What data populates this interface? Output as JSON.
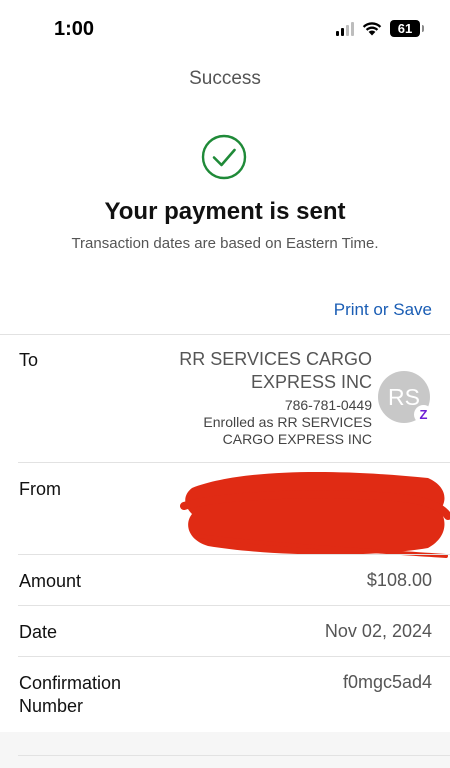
{
  "status_bar": {
    "time": "1:00",
    "battery": "61",
    "icons": [
      "signal-icon",
      "wifi-icon",
      "battery-icon"
    ]
  },
  "nav": {
    "title": "Success"
  },
  "confirmation": {
    "headline": "Your payment is sent",
    "subline": "Transaction dates are based on Eastern Time.",
    "print_link": "Print or Save",
    "icon": "checkmark-circle-icon",
    "accent_color": "#1f8a38"
  },
  "details": {
    "to": {
      "label": "To",
      "name_line1": "RR SERVICES CARGO",
      "name_line2": "EXPRESS INC",
      "phone": "786-781-0449",
      "enrolled_line1": "Enrolled as RR SERVICES",
      "enrolled_line2": "CARGO EXPRESS INC",
      "avatar_initials": "RS",
      "badge": "Z"
    },
    "from": {
      "label": "From",
      "redaction_color": "#e02b14"
    },
    "amount": {
      "label": "Amount",
      "value": "$108.00"
    },
    "date": {
      "label": "Date",
      "value": "Nov 02, 2024"
    },
    "confirmation_number": {
      "label_line1": "Confirmation",
      "label_line2": "Number",
      "value": "f0mgc5ad4"
    }
  },
  "colors": {
    "link": "#1a5db4",
    "zelle_purple": "#6d1ed4"
  }
}
